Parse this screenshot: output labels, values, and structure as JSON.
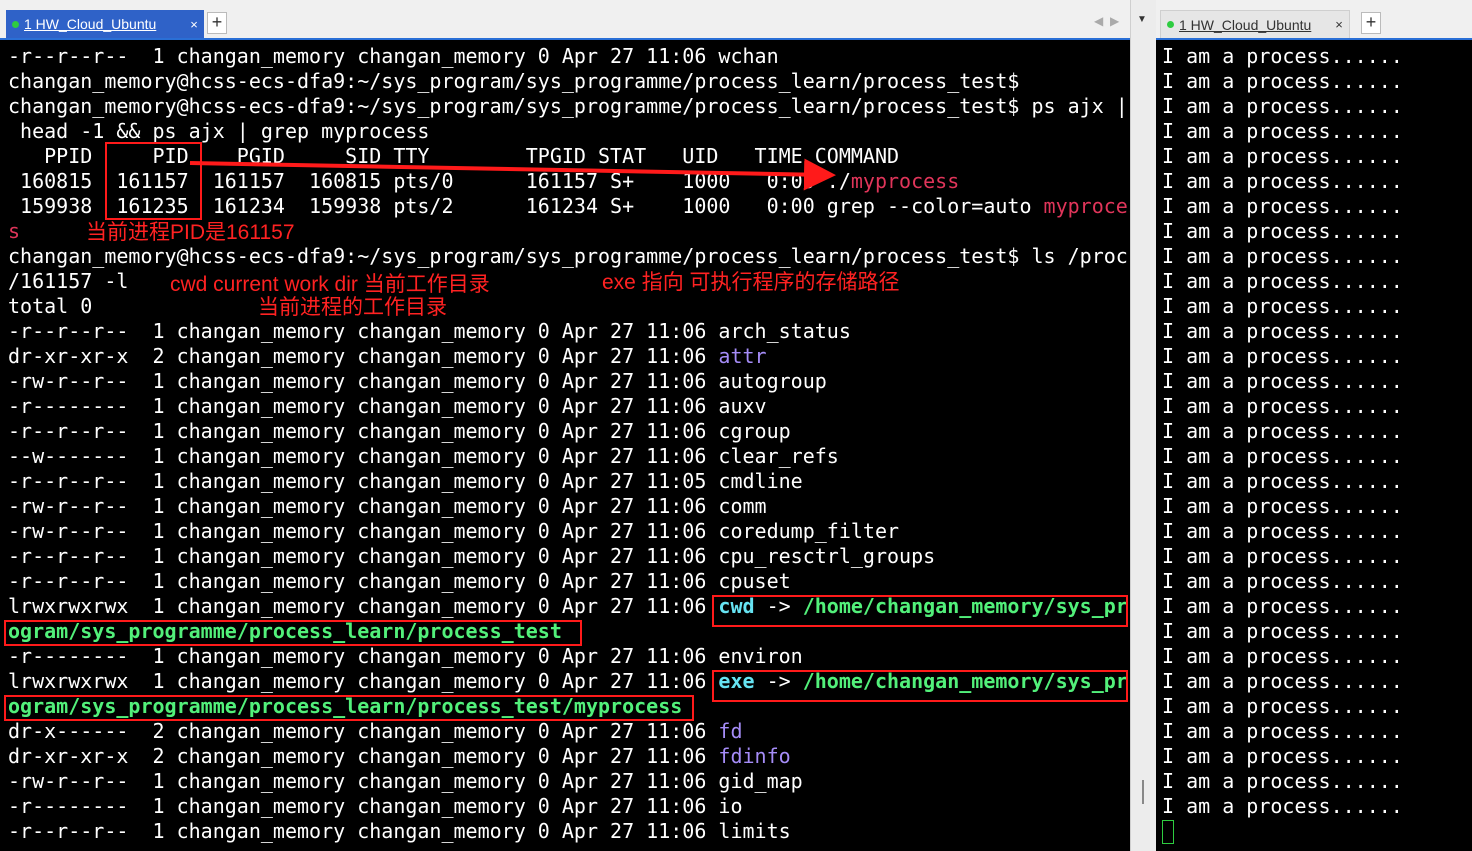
{
  "left_tab": {
    "label": "1 HW_Cloud_Ubuntu",
    "close": "×",
    "new": "+"
  },
  "right_tab": {
    "label": "1 HW_Cloud_Ubuntu",
    "close": "×",
    "new": "+"
  },
  "tab_nav": {
    "prev": "◀",
    "next": "▶",
    "menu": "▼"
  },
  "colors": {
    "purple": "#a58cf7",
    "green": "#52f07a",
    "cyan": "#66e3f2",
    "annotation_red": "#ff2222"
  },
  "terminal": {
    "l01": "-r--r--r--  1 changan_memory changan_memory 0 Apr 27 11:06 wchan",
    "l02": "changan_memory@hcss-ecs-dfa9:~/sys_program/sys_programme/process_learn/process_test$",
    "l03": "changan_memory@hcss-ecs-dfa9:~/sys_program/sys_programme/process_learn/process_test$ ps ajx |",
    "l04": " head -1 && ps ajx | grep myprocess",
    "l05": "   PPID     PID    PGID     SID TTY        TPGID STAT   UID   TIME COMMAND",
    "l06a": " 160815  161157  161157  160815 pts/0      161157 S+    1000   0:00 ./",
    "l06b": "myprocess",
    "l07a": " 159938  161235  161234  159938 pts/2      161234 S+    1000   0:00 grep --color=auto ",
    "l07b": "myproces",
    "l08": "s",
    "l09": "changan_memory@hcss-ecs-dfa9:~/sys_program/sys_programme/process_learn/process_test$ ls /proc",
    "l10": "/161157 -l",
    "l11": "total 0",
    "perm_prefix": "  1 changan_memory changan_memory 0 Apr 27 ",
    "entries": [
      {
        "perm": "-r--r--r--",
        "n": "1",
        "time": "11:06",
        "name": "arch_status",
        "cls": ""
      },
      {
        "perm": "dr-xr-xr-x",
        "n": "2",
        "time": "11:06",
        "name": "attr",
        "cls": "purple"
      },
      {
        "perm": "-rw-r--r--",
        "n": "1",
        "time": "11:06",
        "name": "autogroup",
        "cls": ""
      },
      {
        "perm": "-r--------",
        "n": "1",
        "time": "11:06",
        "name": "auxv",
        "cls": ""
      },
      {
        "perm": "-r--r--r--",
        "n": "1",
        "time": "11:06",
        "name": "cgroup",
        "cls": ""
      },
      {
        "perm": "--w-------",
        "n": "1",
        "time": "11:06",
        "name": "clear_refs",
        "cls": ""
      },
      {
        "perm": "-r--r--r--",
        "n": "1",
        "time": "11:05",
        "name": "cmdline",
        "cls": ""
      },
      {
        "perm": "-rw-r--r--",
        "n": "1",
        "time": "11:06",
        "name": "comm",
        "cls": ""
      },
      {
        "perm": "-rw-r--r--",
        "n": "1",
        "time": "11:06",
        "name": "coredump_filter",
        "cls": ""
      },
      {
        "perm": "-r--r--r--",
        "n": "1",
        "time": "11:06",
        "name": "cpu_resctrl_groups",
        "cls": ""
      },
      {
        "perm": "-r--r--r--",
        "n": "1",
        "time": "11:06",
        "name": "cpuset",
        "cls": ""
      }
    ],
    "cwd_pre": "lrwxrwxrwx  1 changan_memory changan_memory 0 Apr 27 11:06 ",
    "cwd_name": "cwd",
    "cwd_arrow": " -> ",
    "cwd_path1": "/home/changan_memory/sys_pr",
    "cwd_path2": "ogram/sys_programme/process_learn/process_test",
    "environ": "-r--------  1 changan_memory changan_memory 0 Apr 27 11:06 environ",
    "exe_pre": "lrwxrwxrwx  1 changan_memory changan_memory 0 Apr 27 11:06 ",
    "exe_name": "exe",
    "exe_arrow": " -> ",
    "exe_path1": "/home/changan_memory/sys_pr",
    "exe_path2": "ogram/sys_programme/process_learn/process_test/myprocess",
    "tail_entries": [
      {
        "perm": "dr-x------",
        "n": "2",
        "time": "11:06",
        "name": "fd",
        "cls": "purple"
      },
      {
        "perm": "dr-xr-xr-x",
        "n": "2",
        "time": "11:06",
        "name": "fdinfo",
        "cls": "purple"
      },
      {
        "perm": "-rw-r--r--",
        "n": "1",
        "time": "11:06",
        "name": "gid_map",
        "cls": ""
      },
      {
        "perm": "-r--------",
        "n": "1",
        "time": "11:06",
        "name": "io",
        "cls": ""
      },
      {
        "perm": "-r--r--r--",
        "n": "1",
        "time": "11:06",
        "name": "limits",
        "cls": ""
      }
    ]
  },
  "right_terminal": {
    "line": "I am a process......",
    "count": 31
  },
  "annotations": {
    "pid": "当前进程PID是161157",
    "cwd": "cwd current work dir  当前工作目录",
    "cwd2": "当前进程的工作目录",
    "exe": "exe 指向 可执行程序的存储路径"
  }
}
